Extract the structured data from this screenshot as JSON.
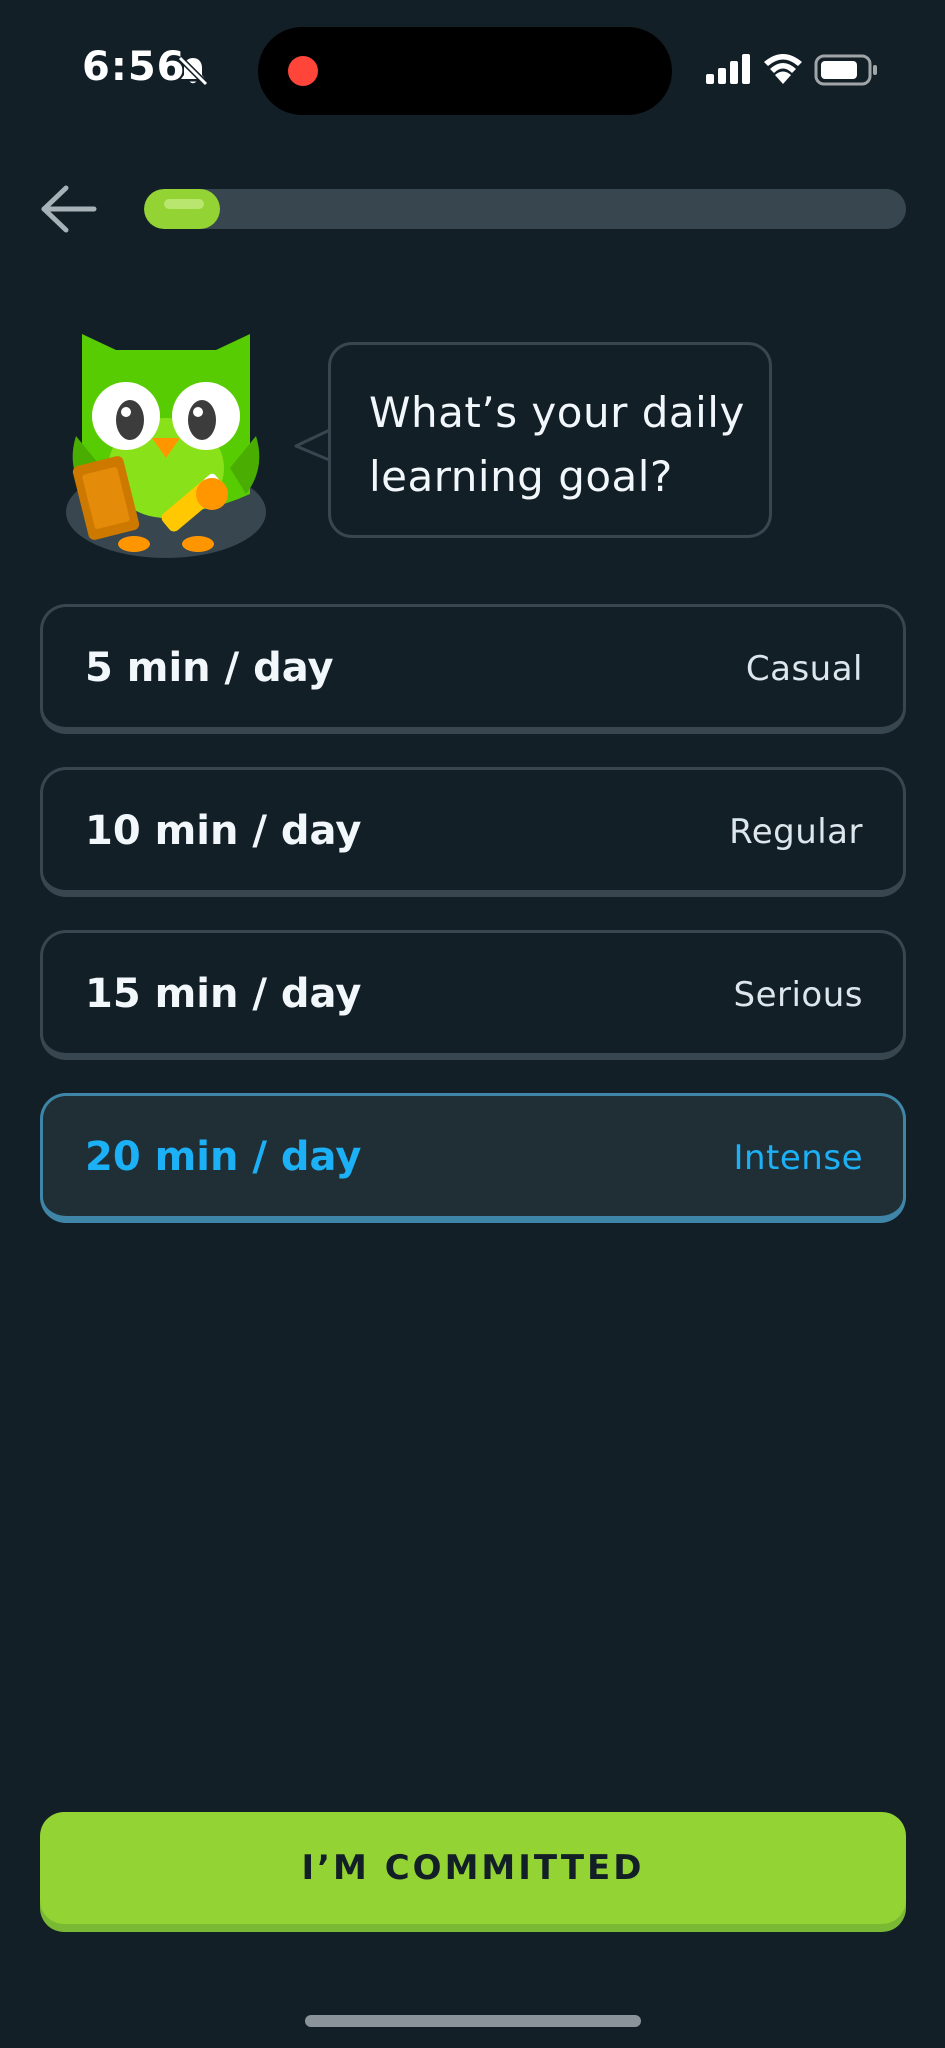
{
  "status_bar": {
    "time": "6:56",
    "icons": [
      "bell-slash-icon",
      "recording-dot-icon",
      "cellular-signal-icon",
      "wifi-icon",
      "battery-icon"
    ]
  },
  "header": {
    "back_icon": "arrow-left-icon",
    "progress_fraction": 0.1
  },
  "prompt": {
    "mascot": "owl-mascot-icon",
    "text": "What’s your daily learning goal?"
  },
  "options": [
    {
      "time": "5 min / day",
      "level": "Casual",
      "selected": false
    },
    {
      "time": "10 min / day",
      "level": "Regular",
      "selected": false
    },
    {
      "time": "15 min / day",
      "level": "Serious",
      "selected": false
    },
    {
      "time": "20 min / day",
      "level": "Intense",
      "selected": true
    }
  ],
  "cta": {
    "label": "I’M COMMITTED"
  },
  "colors": {
    "background": "#131f27",
    "accent_green": "#93d333",
    "selected_blue": "#1cb0f6",
    "border": "#37464f"
  }
}
